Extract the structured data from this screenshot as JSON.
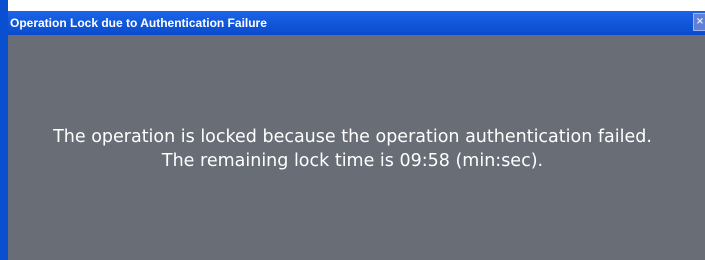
{
  "window": {
    "title": "Operation Lock due to Authentication Failure",
    "close_glyph": "×",
    "accent_color": "#0a4ccc",
    "background_color": "#686d76"
  },
  "message": {
    "line1": "The operation is locked because the operation authentication failed.",
    "line2": "The remaining lock time is 09:58 (min:sec).",
    "remaining_time": "09:58"
  },
  "icons": {
    "close": "close-icon"
  }
}
